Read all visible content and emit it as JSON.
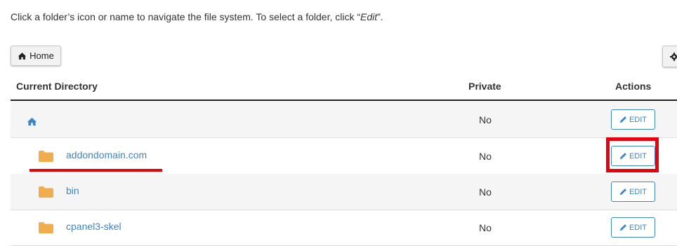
{
  "intro": {
    "text_before": "Click a folder’s icon or name to navigate the file system. To select a folder, click “",
    "text_italic": "Edit",
    "text_after": "”."
  },
  "toolbar": {
    "home_label": "Home",
    "home_icon": "home-icon",
    "settings_icon": "gear-icon"
  },
  "table": {
    "headers": {
      "directory": "Current Directory",
      "private": "Private",
      "actions": "Actions"
    },
    "rows": [
      {
        "name": "",
        "icon": "home-icon",
        "private": "No",
        "action": "EDIT"
      },
      {
        "name": "addondomain.com",
        "icon": "folder-icon",
        "private": "No",
        "action": "EDIT"
      },
      {
        "name": "bin",
        "icon": "folder-icon",
        "private": "No",
        "action": "EDIT"
      },
      {
        "name": "cpanel3-skel",
        "icon": "folder-icon",
        "private": "No",
        "action": "EDIT"
      }
    ]
  },
  "colors": {
    "link": "#3a87c8",
    "folder": "#f0ad4e",
    "annotation": "#e8000d",
    "row_shade": "#f5f5f5"
  }
}
